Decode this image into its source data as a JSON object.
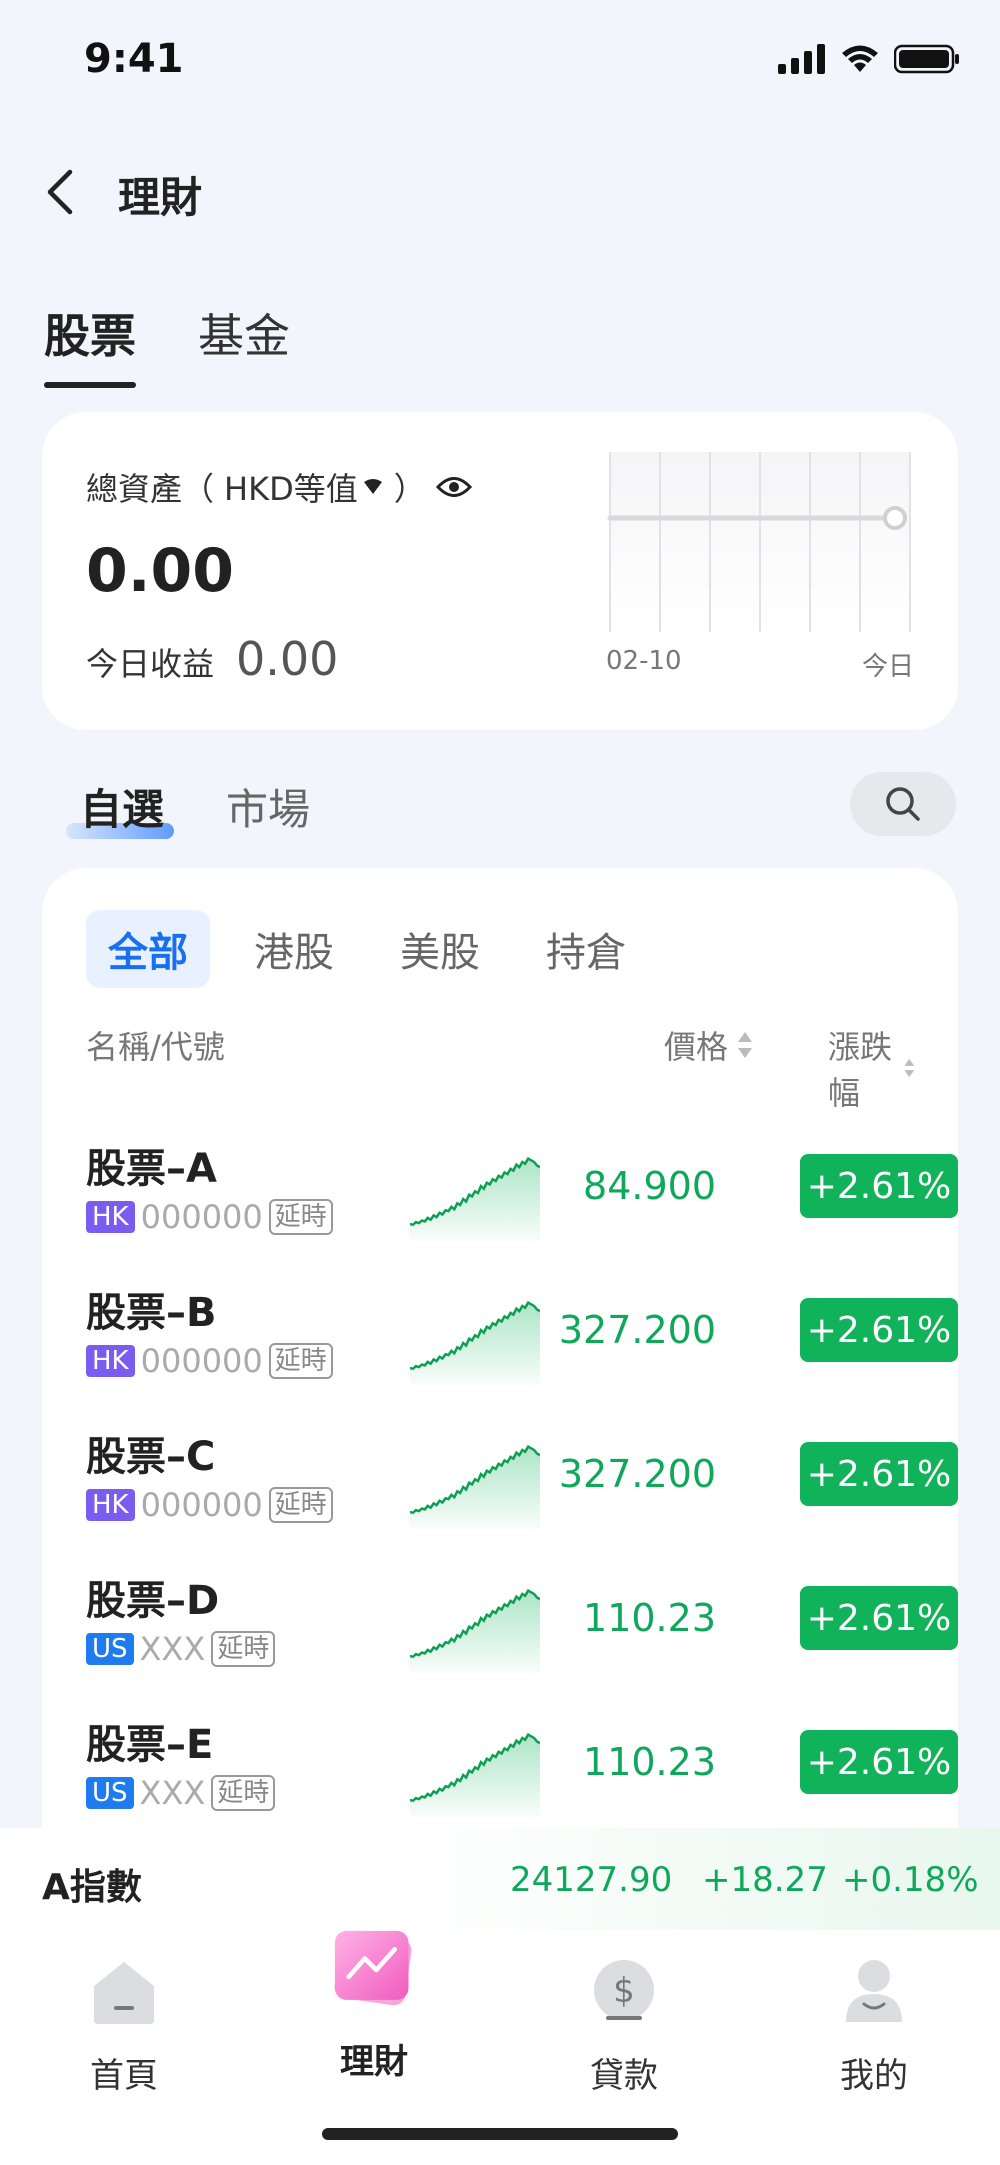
{
  "status": {
    "time": "9:41"
  },
  "nav": {
    "title": "理財"
  },
  "top_tabs": [
    {
      "label": "股票",
      "active": true
    },
    {
      "label": "基金",
      "active": false
    }
  ],
  "asset_card": {
    "label_prefix": "總資產（",
    "currency": "HKD等值",
    "label_suffix": "）",
    "total_value": "0.00",
    "today_label": "今日收益",
    "today_value": "0.00",
    "chart_start_label": "02-10",
    "chart_end_label": "今日"
  },
  "section_tabs": [
    {
      "label": "自選",
      "active": true
    },
    {
      "label": "市場",
      "active": false
    }
  ],
  "filter_tabs": [
    {
      "label": "全部",
      "active": true
    },
    {
      "label": "港股",
      "active": false
    },
    {
      "label": "美股",
      "active": false
    },
    {
      "label": "持倉",
      "active": false
    }
  ],
  "columns": {
    "name": "名稱/代號",
    "price": "價格",
    "change": "漲跌幅"
  },
  "stocks": [
    {
      "name": "股票–A",
      "market": "HK",
      "code": "000000",
      "delay": "延時",
      "price": "84.900",
      "change": "+2.61%"
    },
    {
      "name": "股票–B",
      "market": "HK",
      "code": "000000",
      "delay": "延時",
      "price": "327.200",
      "change": "+2.61%"
    },
    {
      "name": "股票–C",
      "market": "HK",
      "code": "000000",
      "delay": "延時",
      "price": "327.200",
      "change": "+2.61%"
    },
    {
      "name": "股票–D",
      "market": "US",
      "code": "XXX",
      "delay": "延時",
      "price": "110.23",
      "change": "+2.61%"
    },
    {
      "name": "股票–E",
      "market": "US",
      "code": "XXX",
      "delay": "延時",
      "price": "110.23",
      "change": "+2.61%"
    }
  ],
  "index_bar": {
    "name": "A指數",
    "value": "24127.90",
    "change": "+18.27",
    "pct": "+0.18%"
  },
  "tab_bar": [
    {
      "label": "首頁",
      "icon": "home-icon",
      "active": false
    },
    {
      "label": "理財",
      "icon": "wealth-icon",
      "active": true
    },
    {
      "label": "貸款",
      "icon": "loan-icon",
      "active": false
    },
    {
      "label": "我的",
      "icon": "profile-icon",
      "active": false
    }
  ],
  "colors": {
    "up_green": "#10b25a",
    "accent_blue": "#1a6ff0",
    "hk_badge": "#7b5cf0",
    "us_badge": "#1e7bf0"
  }
}
